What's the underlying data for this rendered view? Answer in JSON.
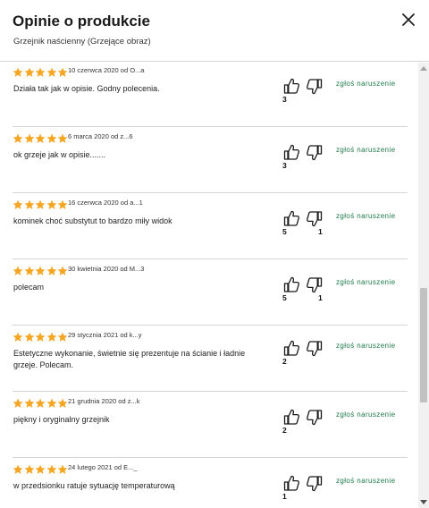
{
  "header": {
    "title": "Opinie o produkcie",
    "subtitle": "Grzejnik naścienny (Grzejące obraz)"
  },
  "colors": {
    "star": "#f5a623",
    "report_link": "#1f7a4a"
  },
  "icons": {
    "close": "close-icon",
    "like": "thumbs-up-icon",
    "dislike": "thumbs-down-icon",
    "star": "star-icon"
  },
  "reviews": [
    {
      "rating": 5,
      "meta": "10 czerwca 2020 od O...a",
      "text": "Działa tak jak w opisie. Godny polecenia.",
      "likes": "3",
      "dislikes": "",
      "report": "zgłoś naruszenie"
    },
    {
      "rating": 5,
      "meta": "6 marca 2020 od z...6",
      "text": "ok grzeje jak w opisie.......",
      "likes": "3",
      "dislikes": "",
      "report": "zgłoś naruszenie"
    },
    {
      "rating": 5,
      "meta": "16 czerwca 2020 od a...1",
      "text": "kominek choć substytut to bardzo miły widok",
      "likes": "5",
      "dislikes": "1",
      "report": "zgłoś naruszenie"
    },
    {
      "rating": 5,
      "meta": "30 kwietnia 2020 od M...3",
      "text": "polecam",
      "likes": "5",
      "dislikes": "1",
      "report": "zgłoś naruszenie"
    },
    {
      "rating": 5,
      "meta": "29 stycznia 2021 od k...y",
      "text": "Estetyczne wykonanie, świetnie się prezentuje na ścianie i ładnie grzeje. Polecam.",
      "likes": "2",
      "dislikes": "",
      "report": "zgłoś naruszenie"
    },
    {
      "rating": 5,
      "meta": "21 grudnia 2020 od z...k",
      "text": "piękny i oryginalny grzejnik",
      "likes": "2",
      "dislikes": "",
      "report": "zgłoś naruszenie"
    },
    {
      "rating": 5,
      "meta": "24 lutego 2021 od E..._",
      "text": "w przedsionku ratuje sytuację temperaturową",
      "likes": "1",
      "dislikes": "",
      "report": "zgłoś naruszenie"
    }
  ]
}
